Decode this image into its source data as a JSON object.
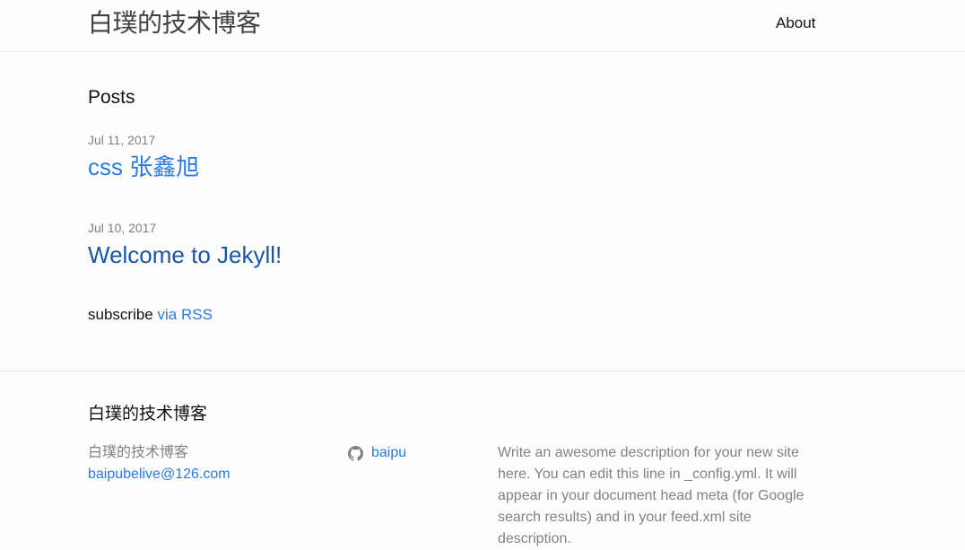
{
  "header": {
    "site_title": "白璞的技术博客",
    "nav": [
      {
        "label": "About"
      }
    ]
  },
  "main": {
    "heading": "Posts",
    "posts": [
      {
        "date": "Jul 11, 2017",
        "title": "css 张鑫旭"
      },
      {
        "date": "Jul 10, 2017",
        "title": "Welcome to Jekyll!"
      }
    ],
    "rss": {
      "prefix": "subscribe",
      "link_label": "via RSS"
    }
  },
  "footer": {
    "heading": "白璞的技术博客",
    "name": "白璞的技术博客",
    "email": "baipubelive@126.com",
    "github": {
      "icon": "github-icon",
      "username": "baipu"
    },
    "description": "Write an awesome description for your new site here. You can edit this line in _config.yml. It will appear in your document head meta (for Google search results) and in your feed.xml site description."
  },
  "colors": {
    "link": "#2a7ae2",
    "visited_link": "#1756a9",
    "meta_text": "#828282",
    "border": "#e8e8e8",
    "background": "#fdfdfd"
  }
}
